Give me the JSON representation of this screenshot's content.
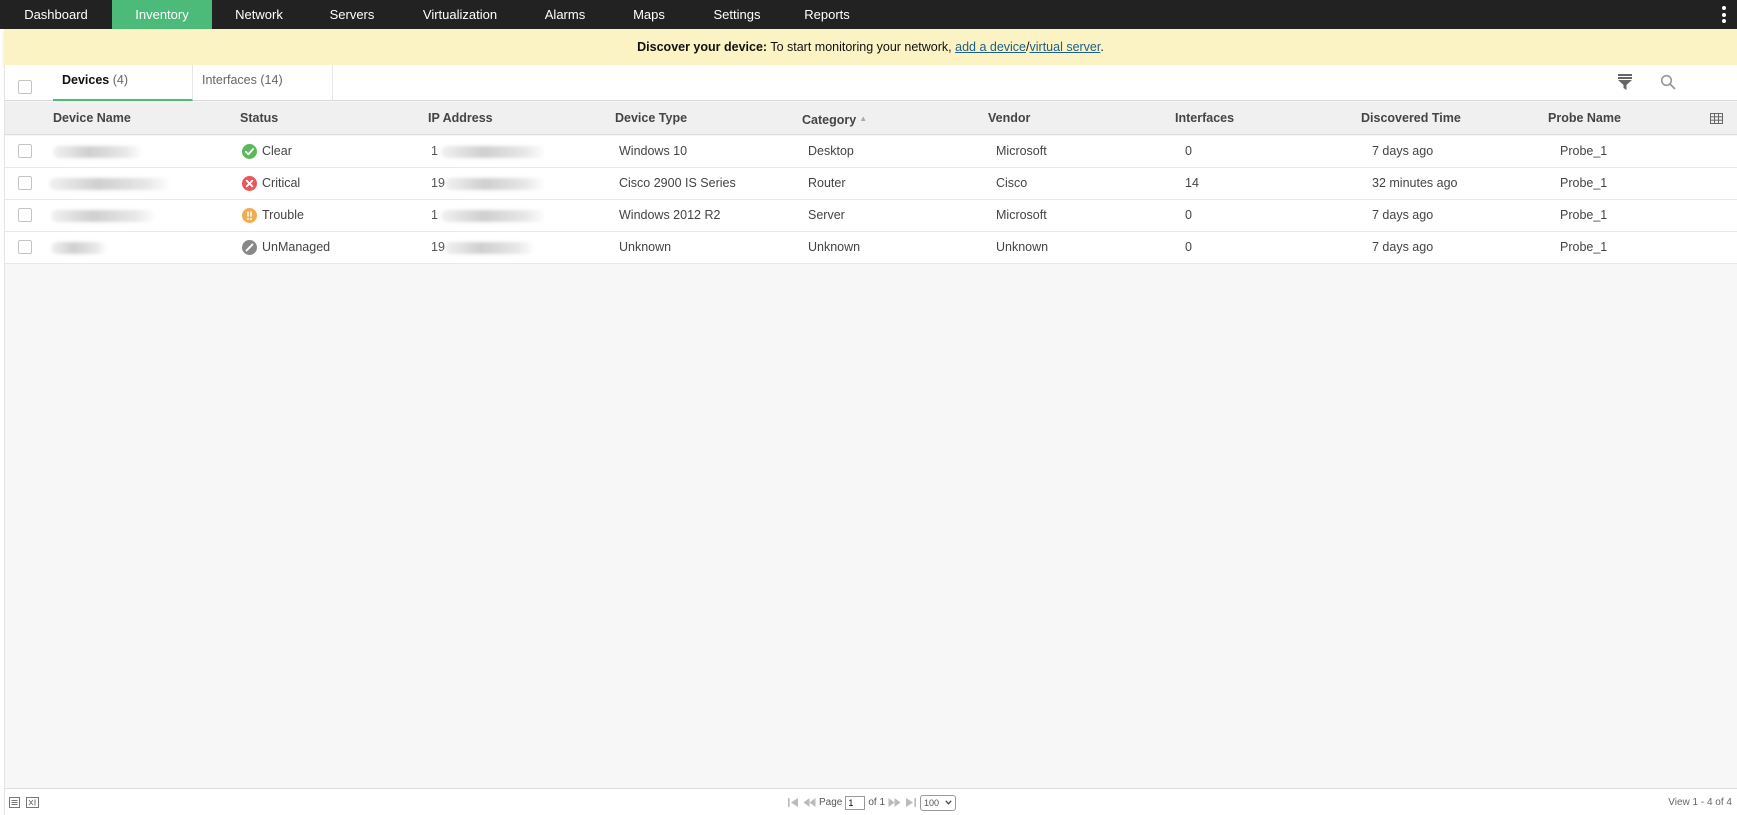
{
  "nav": {
    "items": [
      {
        "label": "Dashboard",
        "active": false
      },
      {
        "label": "Inventory",
        "active": true
      },
      {
        "label": "Network",
        "active": false
      },
      {
        "label": "Servers",
        "active": false
      },
      {
        "label": "Virtualization",
        "active": false
      },
      {
        "label": "Alarms",
        "active": false
      },
      {
        "label": "Maps",
        "active": false
      },
      {
        "label": "Settings",
        "active": false
      },
      {
        "label": "Reports",
        "active": false
      }
    ],
    "active_color": "#4cba78",
    "bg_color": "#222222"
  },
  "banner": {
    "title": "Discover your device:",
    "text": " To start monitoring your network, ",
    "link_device": "add a device",
    "separator": "/",
    "link_virtual": "virtual server",
    "end": "."
  },
  "tabs": {
    "devices": {
      "label": "Devices",
      "count": "(4)"
    },
    "interfaces": {
      "label": "Interfaces",
      "count": "(14)"
    }
  },
  "table": {
    "columns": {
      "device_name": "Device Name",
      "status": "Status",
      "ip_address": "IP Address",
      "device_type": "Device Type",
      "category": "Category",
      "vendor": "Vendor",
      "interfaces": "Interfaces",
      "discovered_time": "Discovered Time",
      "probe_name": "Probe Name"
    },
    "rows": [
      {
        "ip_prefix": "1",
        "status": "Clear",
        "status_icon": "check-circle-icon",
        "status_color": "#5cb85c",
        "device_type": "Windows 10",
        "category": "Desktop",
        "vendor": "Microsoft",
        "interfaces": "0",
        "discovered_time": "7 days ago",
        "probe_name": "Probe_1"
      },
      {
        "ip_prefix": "19",
        "status": "Critical",
        "status_icon": "x-circle-icon",
        "status_color": "#e8575a",
        "device_type": "Cisco 2900 IS Series",
        "category": "Router",
        "vendor": "Cisco",
        "interfaces": "14",
        "discovered_time": "32 minutes ago",
        "probe_name": "Probe_1"
      },
      {
        "ip_prefix": "1",
        "status": "Trouble",
        "status_icon": "exclamation-circle-icon",
        "status_color": "#f0ad4e",
        "device_type": "Windows 2012 R2",
        "category": "Server",
        "vendor": "Microsoft",
        "interfaces": "0",
        "discovered_time": "7 days ago",
        "probe_name": "Probe_1"
      },
      {
        "ip_prefix": "19",
        "status": "UnManaged",
        "status_icon": "unmanaged-circle-icon",
        "status_color": "#888888",
        "device_type": "Unknown",
        "category": "Unknown",
        "vendor": "Unknown",
        "interfaces": "0",
        "discovered_time": "7 days ago",
        "probe_name": "Probe_1"
      }
    ]
  },
  "footer": {
    "page_label": "Page",
    "page_value": "1",
    "of_label": "of 1",
    "page_size": "100",
    "view_text": "View 1 - 4 of 4"
  }
}
